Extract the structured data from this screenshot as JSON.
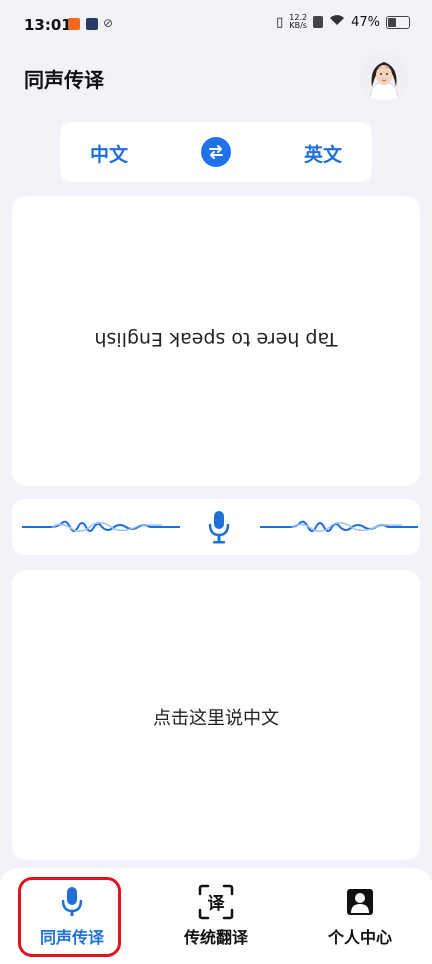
{
  "status_bar": {
    "time": "13:01",
    "net_speed_value": "12.2",
    "net_speed_unit": "KB/s",
    "battery": "47%",
    "battery_level": 0.47
  },
  "header": {
    "title": "同声传译",
    "avatar_icon": "user-avatar"
  },
  "language_bar": {
    "source": "中文",
    "target": "英文",
    "swap_icon": "swap-arrows-icon"
  },
  "top_panel": {
    "prompt": "Tap here to speak English"
  },
  "mic_strip": {
    "mic_icon": "microphone-icon"
  },
  "bottom_panel": {
    "prompt": "点击这里说中文"
  },
  "bottom_nav": {
    "items": [
      {
        "label": "同声传译",
        "icon": "microphone-icon",
        "active": true
      },
      {
        "label": "传统翻译",
        "icon": "translate-icon",
        "active": false
      },
      {
        "label": "个人中心",
        "icon": "person-icon",
        "active": false
      }
    ]
  },
  "colors": {
    "accent": "#1e6fd8",
    "highlight": "#e0141e",
    "background": "#f1f3f8"
  }
}
